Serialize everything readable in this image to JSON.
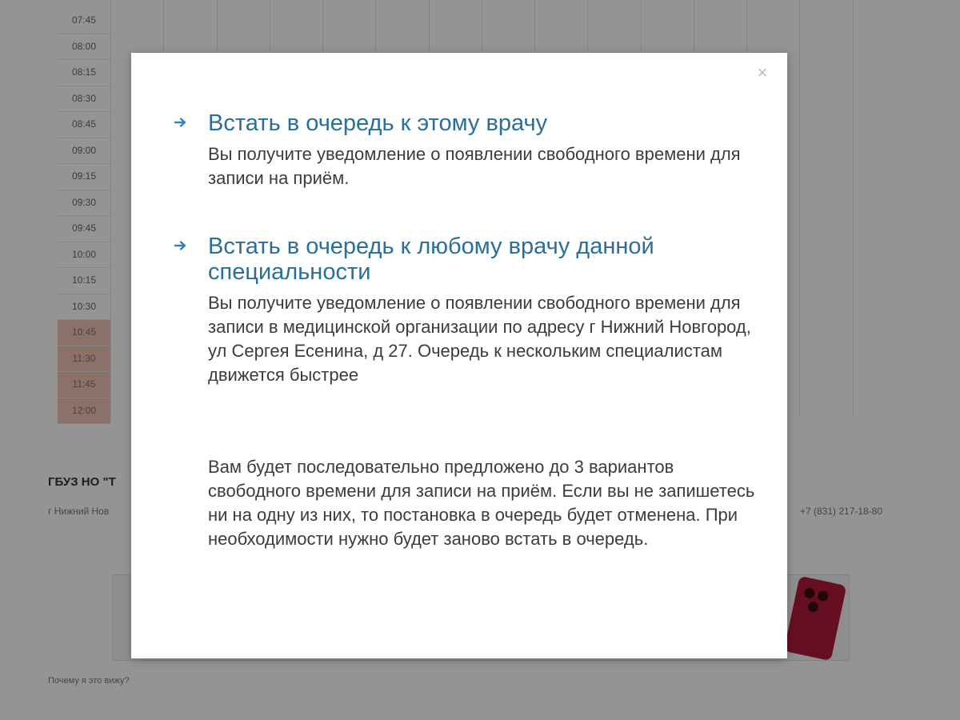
{
  "background": {
    "times": [
      "07:45",
      "08:00",
      "08:15",
      "08:30",
      "08:45",
      "09:00",
      "09:15",
      "09:30",
      "09:45",
      "10:00",
      "10:15",
      "10:30",
      "10:45",
      "11:30",
      "11:45",
      "12:00"
    ],
    "busy_times": [
      "10:45",
      "11:30",
      "11:45",
      "12:00"
    ],
    "clinic_name": "ГБУЗ НО \"Т",
    "clinic_address": "г Нижний Нов",
    "phone": "+7 (831) 217-18-80",
    "ad_link": "Почему я это вижу?"
  },
  "modal": {
    "close_label": "×",
    "options": [
      {
        "title": "Встать в очередь к этому врачу",
        "description": "Вы получите уведомление о появлении свободного времени для записи на приём."
      },
      {
        "title": "Встать в очередь к любому врачу данной специальности",
        "description": "Вы получите уведомление о появлении свободного времени для записи в медицинской организации по адресу г Нижний Новгород, ул Сергея Есенина, д 27. Очередь к нескольким специалистам движется быстрее"
      }
    ],
    "notice": "Вам будет последовательно предложено до 3 вариантов свободного времени для записи на приём. Если вы не запишетесь ни на одну из них, то постановка в очередь будет отменена. При необходимости нужно будет заново встать в очередь."
  },
  "colors": {
    "link": "#2a6f98",
    "text": "#3c3c3c",
    "busy_slot": "#f2c3b6",
    "overlay": "rgba(0,0,0,0.42)"
  },
  "icons": {
    "option_arrow": "arrow-right-icon",
    "close": "close-icon"
  }
}
